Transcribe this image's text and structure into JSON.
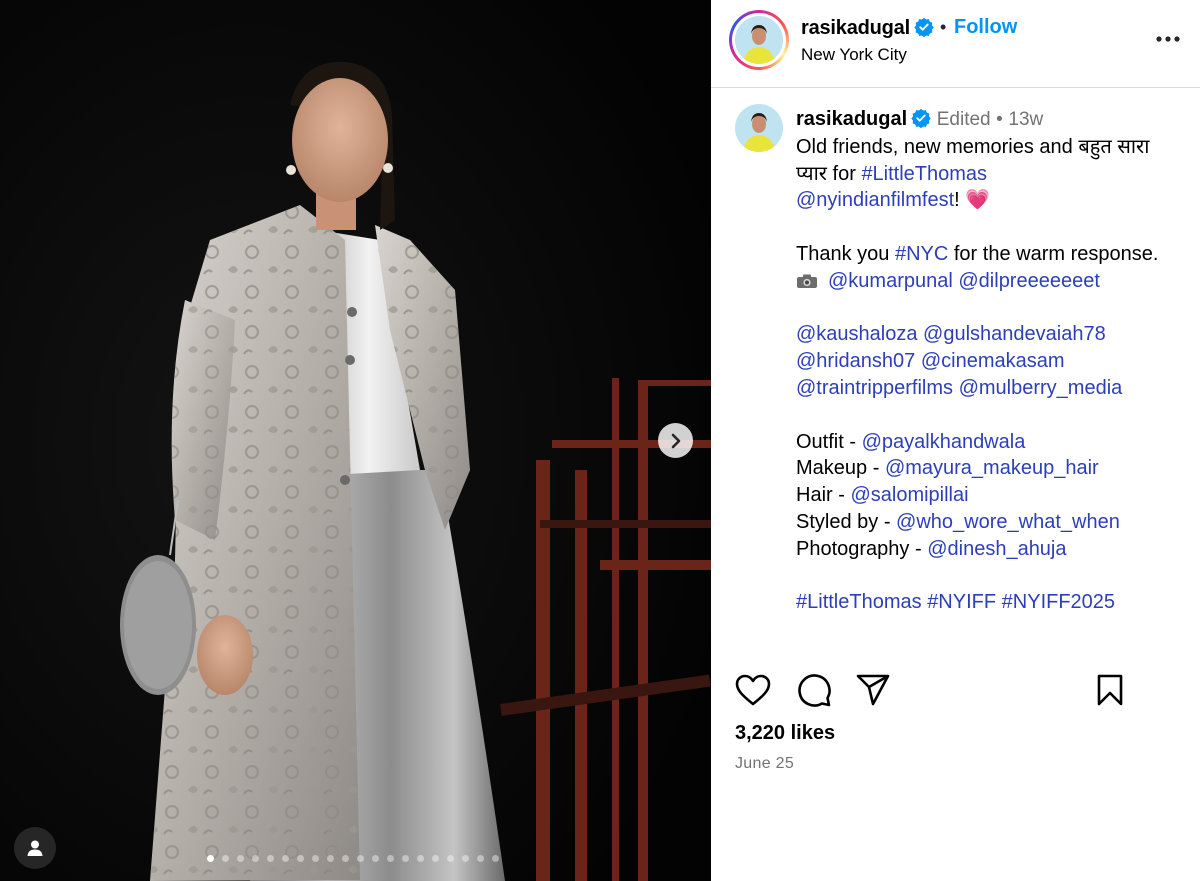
{
  "post": {
    "username": "rasikadugal",
    "follow_label": "Follow",
    "location": "New York City",
    "separator": "•"
  },
  "caption": {
    "username": "rasikadugal",
    "edited": "Edited",
    "time_ago": "13w",
    "line1_text": "Old friends, new memories and बहुत सारा",
    "line2_text": "प्यार for ",
    "line2_tag": "#LittleThomas",
    "line3_mention": "@nyindianfilmfest",
    "line3_suffix": "! 💗",
    "line5_prefix": "Thank you ",
    "line5_tag": "#NYC",
    "line5_suffix": " for the warm response.",
    "line6_mention1": "@kumarpunal",
    "line6_mention2": "@dilpreeeeeeet",
    "line8_mention1": "@kaushaloza",
    "line8_mention2": "@gulshandevaiah78",
    "line9_mention1": "@hridansh07",
    "line9_mention2": "@cinemakasam",
    "line10_mention1": "@traintripperfilms",
    "line10_mention2": "@mulberry_media",
    "credits": [
      {
        "label": "Outfit - ",
        "handle": "@payalkhandwala"
      },
      {
        "label": "Makeup - ",
        "handle": "@mayura_makeup_hair"
      },
      {
        "label": "Hair - ",
        "handle": "@salomipillai"
      },
      {
        "label": "Styled by - ",
        "handle": "@who_wore_what_when"
      },
      {
        "label": "Photography - ",
        "handle": "@dinesh_ahuja"
      }
    ],
    "hashtags": [
      "#LittleThomas",
      "#NYIFF",
      "#NYIFF2025"
    ]
  },
  "engagement": {
    "likes": "3,220 likes",
    "date": "June 25"
  },
  "carousel": {
    "slide_count": 20,
    "active_index": 0
  },
  "icons": {
    "verified": "verified-badge-icon",
    "more": "more-options-icon",
    "like": "heart-icon",
    "comment": "comment-bubble-icon",
    "share": "paper-plane-icon",
    "save": "bookmark-icon",
    "next": "chevron-right-icon",
    "tags": "user-tag-icon",
    "camera": "camera-icon"
  },
  "colors": {
    "link": "#2d3fb8",
    "follow": "#0095f6",
    "verified": "#0095f6",
    "muted": "#737373",
    "heart_emoji": "#f0346e"
  }
}
